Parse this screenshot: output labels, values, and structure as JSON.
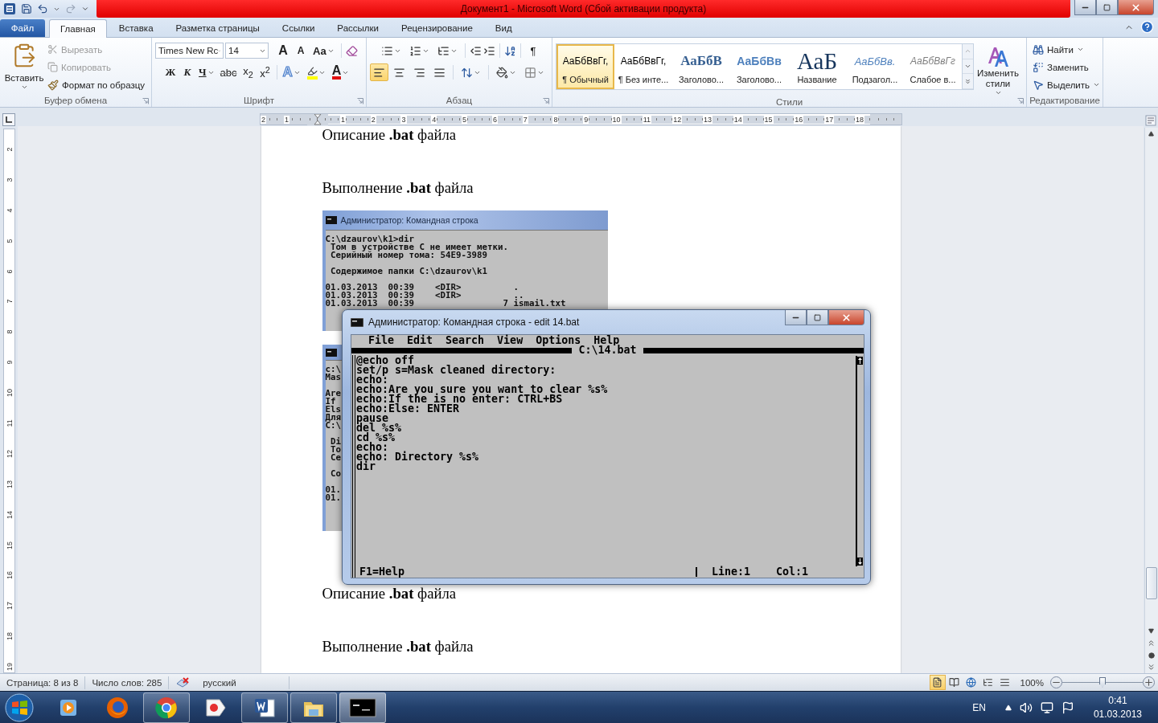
{
  "title_bar": {
    "title": "Документ1  -  Microsoft Word (Сбой активации продукта)"
  },
  "tabs": [
    {
      "label": "Файл",
      "kind": "file",
      "selected": false
    },
    {
      "label": "Главная",
      "kind": "tab",
      "selected": true
    },
    {
      "label": "Вставка",
      "kind": "tab",
      "selected": false
    },
    {
      "label": "Разметка страницы",
      "kind": "tab",
      "selected": false
    },
    {
      "label": "Ссылки",
      "kind": "tab",
      "selected": false
    },
    {
      "label": "Рассылки",
      "kind": "tab",
      "selected": false
    },
    {
      "label": "Рецензирование",
      "kind": "tab",
      "selected": false
    },
    {
      "label": "Вид",
      "kind": "tab",
      "selected": false
    }
  ],
  "clipboard": {
    "label": "Буфер обмена",
    "paste": "Вставить",
    "items": [
      {
        "kind": "cut",
        "label": "Вырезать",
        "disabled": true
      },
      {
        "kind": "copy",
        "label": "Копировать",
        "disabled": true
      },
      {
        "kind": "format",
        "label": "Формат по образцу",
        "disabled": false
      }
    ]
  },
  "font": {
    "label": "Шрифт",
    "name": "Times New Rc",
    "size": "14",
    "size_buttons": [
      {
        "kind": "grow",
        "label": "A"
      },
      {
        "kind": "shrink",
        "label": "A"
      },
      {
        "kind": "case",
        "label": "Aa"
      }
    ],
    "style_buttons": [
      {
        "kind": "bold",
        "label": "Ж"
      },
      {
        "kind": "italic",
        "label": "К"
      },
      {
        "kind": "underline",
        "label": "Ч"
      },
      {
        "kind": "strike",
        "label": "abc"
      },
      {
        "kind": "sub",
        "label": "x$_{2}$"
      },
      {
        "kind": "sup",
        "label": "x$^{2}$"
      }
    ],
    "color_buttons": [
      {
        "kind": "effects",
        "label": "A"
      },
      {
        "kind": "highlight"
      },
      {
        "kind": "color",
        "label": "A"
      }
    ]
  },
  "paragraph": {
    "label": "Абзац",
    "pilcrow": "¶",
    "aligns": [
      {
        "kind": "left",
        "selected": true
      },
      {
        "kind": "center",
        "selected": false
      },
      {
        "kind": "right",
        "selected": false
      },
      {
        "kind": "justify",
        "selected": false
      }
    ]
  },
  "styles": {
    "label": "Стили",
    "change": "Изменить стили",
    "items": [
      {
        "kind": "normal",
        "preview": "АаБбВвГг,",
        "name": "¶ Обычный",
        "selected": true
      },
      {
        "kind": "normal",
        "preview": "АаБбВвГг,",
        "name": "¶ Без инте...",
        "selected": false
      },
      {
        "kind": "heading1",
        "preview": "АаБбВ",
        "name": "Заголово...",
        "selected": false
      },
      {
        "kind": "heading2",
        "preview": "АаБбВв",
        "name": "Заголово...",
        "selected": false
      },
      {
        "kind": "title",
        "preview": "АаБ",
        "name": "Название",
        "selected": false
      },
      {
        "kind": "subtitle",
        "preview": "АаБбВв.",
        "name": "Подзагол...",
        "selected": false
      },
      {
        "kind": "subtle",
        "preview": "АаБбВвГг",
        "name": "Слабое в...",
        "selected": false
      }
    ]
  },
  "editing": {
    "label": "Редактирование",
    "items": [
      {
        "kind": "find",
        "label": "Найти",
        "dropdown": true
      },
      {
        "kind": "replace",
        "label": "Заменить",
        "dropdown": false
      },
      {
        "kind": "select",
        "label": "Выделить",
        "dropdown": true
      }
    ]
  },
  "ruler": {
    "left_marks": [
      "2",
      "1"
    ],
    "marks": [
      "1",
      "2",
      "3",
      "4",
      "5",
      "6",
      "7",
      "8",
      "9",
      "10",
      "11",
      "12",
      "13",
      "14",
      "15",
      "16",
      "17",
      "18"
    ]
  },
  "vertical_ruler": {
    "marks": [
      "2",
      "3",
      "4",
      "5",
      "6",
      "7",
      "8",
      "9",
      "10",
      "11",
      "12",
      "13",
      "14",
      "15",
      "16",
      "17",
      "18",
      "19"
    ]
  },
  "document": {
    "blocks": [
      {
        "kind": "heading",
        "text": "Описание **.bat** файла"
      },
      {
        "kind": "heading",
        "text": "Выполнение **.bat** файла"
      },
      {
        "kind": "console",
        "title": "Администратор: Командная строка",
        "groups": [
          [
            "C:\\dzaurov\\k1>dir",
            " Том в устройстве C не имеет метки.",
            " Серийный номер тома: 54E9-3989"
          ],
          [
            " Содержимое папки C:\\dzaurov\\k1"
          ],
          [
            "01.03.2013  00:39    <DIR>          .",
            "01.03.2013  00:39    <DIR>          ..",
            "01.03.2013  00:39                 7 ismail.txt"
          ]
        ]
      },
      {
        "kind": "console",
        "groups": [
          [
            "c:\\",
            "Mas"
          ],
          [
            "Are",
            "If",
            "Els",
            "Для",
            "C:\\"
          ],
          [
            " Di",
            " To",
            " Ce"
          ],
          [
            " Co"
          ],
          [
            "01.",
            "01."
          ]
        ]
      },
      {
        "kind": "heading",
        "text": "Описание **.bat** файла"
      },
      {
        "kind": "heading",
        "text": "Выполнение **.bat** файла"
      }
    ]
  },
  "editor": {
    "title": "Администратор: Командная строка - edit  14.bat",
    "menu": [
      "File",
      "Edit",
      "Search",
      "View",
      "Options",
      "Help"
    ],
    "file": "C:\\14.bat",
    "lines": [
      "@echo off",
      "set/p s=Mask cleaned directory:",
      "echo:",
      "echo:Are you sure you want to clear %s%",
      "echo:If the is no enter: CTRL+BS",
      "echo:Else: ENTER",
      "pause",
      "del %s%",
      "cd %s%",
      "echo:",
      "echo: Directory %s%",
      "dir"
    ],
    "help": "F1=Help",
    "line": "Line:1",
    "col": "Col:1"
  },
  "status_bar": {
    "page": "Страница: 8 из 8",
    "words": "Число слов: 285",
    "language": "русский",
    "views": [
      {
        "kind": "print",
        "selected": true
      },
      {
        "kind": "reading",
        "selected": false
      },
      {
        "kind": "web",
        "selected": false
      },
      {
        "kind": "outline",
        "selected": false
      },
      {
        "kind": "draft",
        "selected": false
      }
    ],
    "zoom": "100%",
    "level": 0.5
  },
  "taskbar": {
    "apps": [
      {
        "kind": "media",
        "running": false,
        "selected": false
      },
      {
        "kind": "firefox",
        "running": false,
        "selected": false
      },
      {
        "kind": "chrome",
        "running": true,
        "selected": false
      },
      {
        "kind": "yandex",
        "running": false,
        "selected": false
      },
      {
        "kind": "word",
        "running": true,
        "selected": false
      },
      {
        "kind": "explorer",
        "running": true,
        "selected": false
      },
      {
        "kind": "console",
        "running": true,
        "selected": true
      }
    ],
    "language": "EN",
    "time": "0:41",
    "date": "01.03.2013"
  }
}
